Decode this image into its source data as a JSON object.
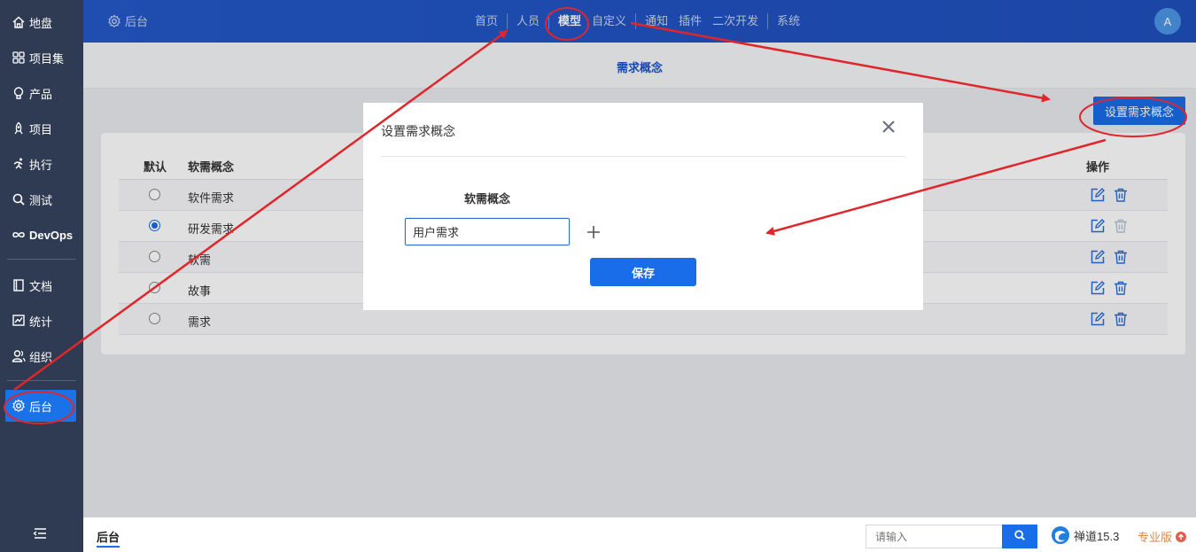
{
  "sidebar": {
    "items": [
      {
        "label": "地盘",
        "icon": "home-icon"
      },
      {
        "label": "项目集",
        "icon": "grid-icon"
      },
      {
        "label": "产品",
        "icon": "bulb-icon"
      },
      {
        "label": "项目",
        "icon": "rocket-icon"
      },
      {
        "label": "执行",
        "icon": "run-icon"
      },
      {
        "label": "测试",
        "icon": "search-icon"
      },
      {
        "label": "DevOps",
        "icon": "infinity-icon"
      },
      {
        "label": "文档",
        "icon": "book-icon"
      },
      {
        "label": "统计",
        "icon": "chart-icon"
      },
      {
        "label": "组织",
        "icon": "users-icon"
      },
      {
        "label": "后台",
        "icon": "gear-icon",
        "active": true
      }
    ]
  },
  "header": {
    "title": "后台",
    "nav": [
      "首页",
      "人员",
      "模型",
      "自定义",
      "通知",
      "插件",
      "二次开发",
      "系统"
    ],
    "active_nav": "模型",
    "avatar": "A"
  },
  "page": {
    "title": "需求概念",
    "set_button": "设置需求概念",
    "table": {
      "headers": {
        "default": "默认",
        "name": "软需概念",
        "actions": "操作"
      },
      "rows": [
        {
          "name": "软件需求",
          "checked": false
        },
        {
          "name": "研发需求",
          "checked": true
        },
        {
          "name": "软需",
          "checked": false
        },
        {
          "name": "故事",
          "checked": false
        },
        {
          "name": "需求",
          "checked": false
        }
      ]
    }
  },
  "modal": {
    "title": "设置需求概念",
    "field_label": "软需概念",
    "input_value": "用户需求",
    "save_label": "保存"
  },
  "footer": {
    "tab": "后台",
    "search_placeholder": "请输入",
    "brand": "禅道15.3",
    "edition": "专业版"
  },
  "colors": {
    "accent": "#1a6de8",
    "sidebar_bg": "#2f3b52",
    "header_bg": "#2056c4",
    "annotation": "#e0252b"
  }
}
